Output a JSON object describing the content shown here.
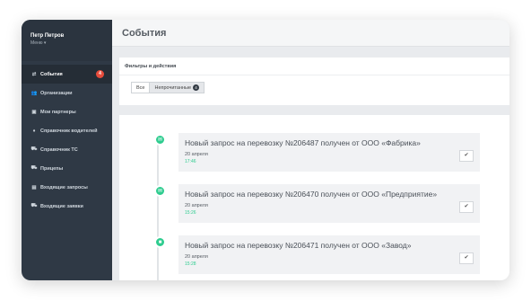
{
  "user": {
    "name": "Петр Петров",
    "menu": "Меню ▾"
  },
  "nav": [
    {
      "label": "События",
      "icon": "⇄",
      "icon_name": "exchange-icon",
      "active": true,
      "badge": "4"
    },
    {
      "label": "Организации",
      "icon": "👥",
      "icon_name": "users-icon"
    },
    {
      "label": "Мои партнеры",
      "icon": "▣",
      "icon_name": "partners-icon"
    },
    {
      "label": "Справочник водителей",
      "icon": "♦",
      "icon_name": "driver-icon"
    },
    {
      "label": "Справочник ТС",
      "icon": "⛟",
      "icon_name": "car-icon"
    },
    {
      "label": "Прицепы",
      "icon": "⛟",
      "icon_name": "car-icon"
    },
    {
      "label": "Входящие запросы",
      "icon": "▤",
      "icon_name": "document-icon"
    },
    {
      "label": "Входящие заявки",
      "icon": "⛟",
      "icon_name": "car-icon"
    }
  ],
  "page": {
    "title": "События"
  },
  "filters": {
    "heading": "Фильтры и действия",
    "all_label": "Все",
    "unread_label": "Непрочитанные",
    "unread_count": "4"
  },
  "events": [
    {
      "title": "Новый запрос на перевозку №206487 получен от ООО «Фабрика»",
      "date": "20 апреля",
      "time": "17:46",
      "check": "✔"
    },
    {
      "title": "Новый запрос на перевозку №206470 получен от ООО «Предприятие»",
      "date": "20 апреля",
      "time": "15:26",
      "check": "✔"
    },
    {
      "title": "Новый запрос на перевозку №206471 получен от ООО «Завод»",
      "date": "20 апреля",
      "time": "15:28",
      "check": "✔"
    }
  ],
  "colors": {
    "sidebar": "#2f3945",
    "accent": "#2ecc8f",
    "badge": "#e74c3c"
  }
}
